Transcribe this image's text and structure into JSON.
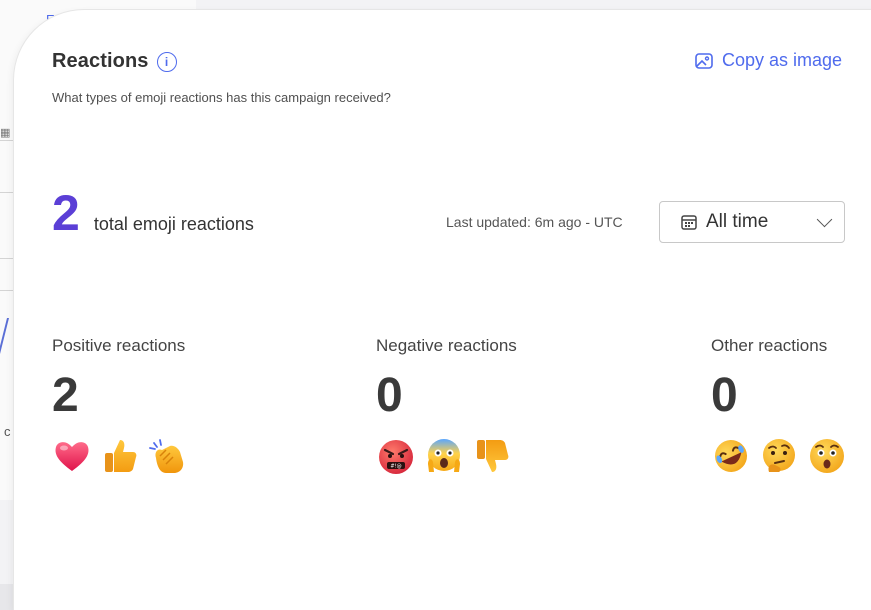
{
  "background": {
    "edit_link": "Edi",
    "cut_text": "c"
  },
  "card": {
    "title": "Reactions",
    "info_glyph": "i",
    "subtitle": "What types of emoji reactions has this campaign received?",
    "copy_button": "Copy as image",
    "total": {
      "value": "2",
      "label": "total emoji reactions"
    },
    "last_updated": "Last updated: 6m ago - UTC",
    "timeframe": {
      "selected": "All time"
    },
    "columns": [
      {
        "label": "Positive reactions",
        "count": "2",
        "emojis": [
          "heart-emoji",
          "thumbs-up-emoji",
          "clapping-hands-emoji"
        ]
      },
      {
        "label": "Negative reactions",
        "count": "0",
        "emojis": [
          "angry-face-emoji",
          "screaming-face-emoji",
          "thumbs-down-emoji"
        ]
      },
      {
        "label": "Other reactions",
        "count": "0",
        "emojis": [
          "rolling-laughing-emoji",
          "thinking-face-emoji",
          "surprised-face-emoji"
        ]
      }
    ]
  },
  "colors": {
    "accent": "#4f6bed",
    "total_number": "#5b3fd6"
  }
}
